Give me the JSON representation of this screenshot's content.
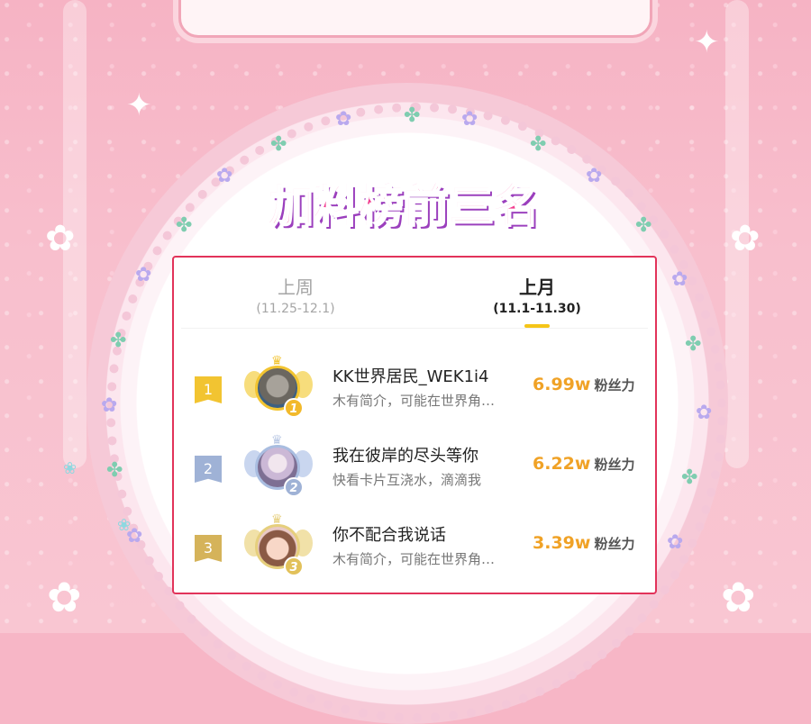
{
  "title": "加料榜前三名",
  "tabs": [
    {
      "label": "上周",
      "range": "(11.25-12.1)",
      "active": false
    },
    {
      "label": "上月",
      "range": "(11.1-11.30)",
      "active": true
    }
  ],
  "ranking": [
    {
      "rank": "1",
      "badge": "1",
      "name": "KK世界居民_WEK1i4",
      "bio": "木有简介，可能在世界角…",
      "score": "6.99w",
      "unit": "粉丝力"
    },
    {
      "rank": "2",
      "badge": "2",
      "name": "我在彼岸的尽头等你",
      "bio": "快看卡片互浇水，滴滴我",
      "score": "6.22w",
      "unit": "粉丝力"
    },
    {
      "rank": "3",
      "badge": "3",
      "name": "你不配合我说话",
      "bio": "木有简介，可能在世界角…",
      "score": "3.39w",
      "unit": "粉丝力"
    }
  ],
  "colors": {
    "accent_border": "#e2335a",
    "score": "#f0a226",
    "rank_gold": "#f2c431",
    "rank_silver": "#9fb2d6",
    "rank_bronze": "#d5b35a",
    "tab_indicator": "#f5c518"
  },
  "icons": {
    "crown": "crown-icon",
    "flower": "flower-icon",
    "sparkle": "sparkle-icon"
  }
}
